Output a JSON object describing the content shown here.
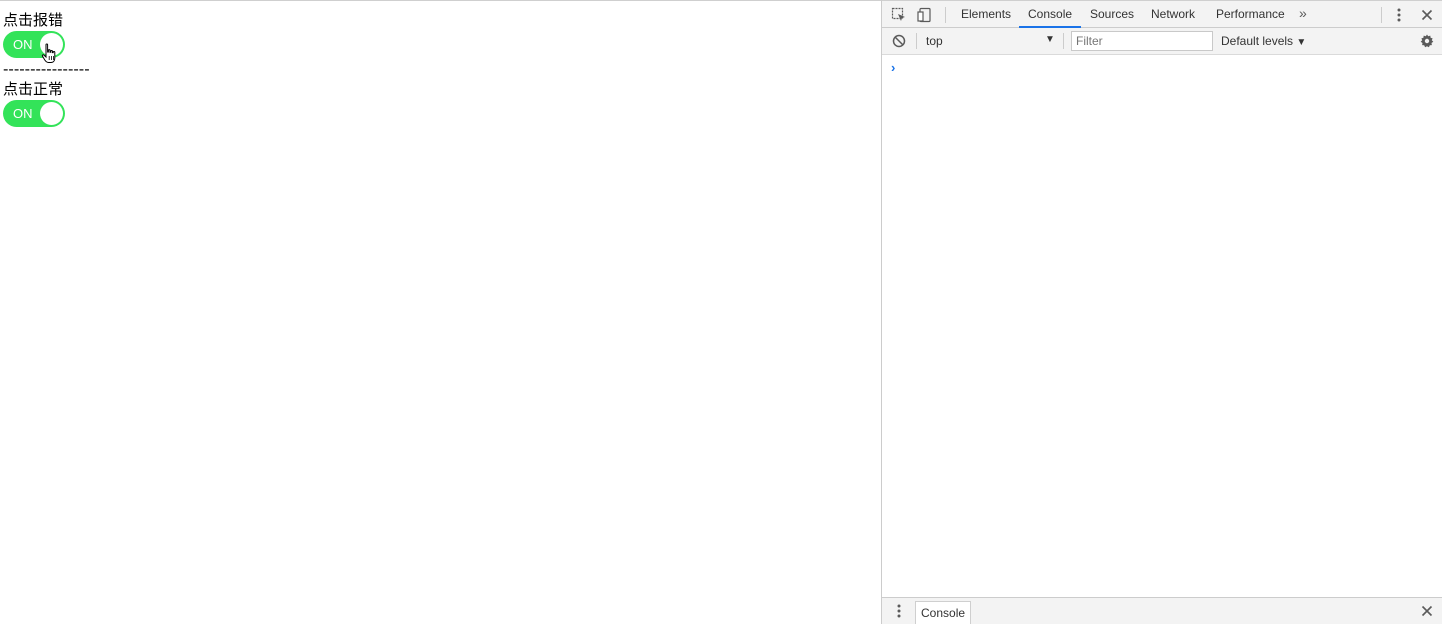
{
  "page": {
    "toggle_error_label": "点击报错",
    "toggle_normal_label": "点击正常",
    "divider": "----------------",
    "switch_on_text": "ON",
    "switch_color": "#33e359"
  },
  "devtools": {
    "tabs": [
      {
        "label": "Elements",
        "active": false
      },
      {
        "label": "Console",
        "active": true
      },
      {
        "label": "Sources",
        "active": false
      },
      {
        "label": "Network",
        "active": false
      },
      {
        "label": "Performance",
        "active": false
      }
    ],
    "more_tabs_glyph": "»",
    "context": "top",
    "filter_placeholder": "Filter",
    "levels_label": "Default levels",
    "prompt_glyph": "›",
    "drawer_tab": "Console",
    "accent_color": "#1a73e8"
  }
}
